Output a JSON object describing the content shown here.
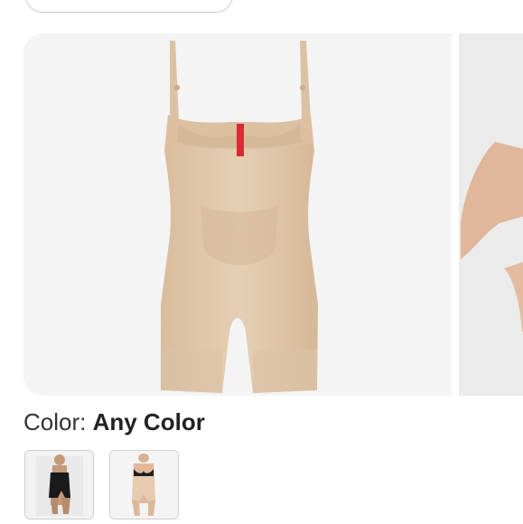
{
  "color_selector": {
    "label": "Color:",
    "value": "Any Color"
  },
  "gallery": {
    "images": [
      {
        "subject": "nude open-bust mid-thigh bodysuit shapewear product photo"
      },
      {
        "subject": "model wearing nude bodysuit, partially visible"
      }
    ]
  },
  "swatches": [
    {
      "name": "black bodysuit on model"
    },
    {
      "name": "nude bodysuit on model"
    }
  ],
  "colors": {
    "product_nude": "#e2c9ae",
    "product_shadow": "#cfb295",
    "tag_red": "#d92b32",
    "swatch_border": "#cfcfcf"
  }
}
